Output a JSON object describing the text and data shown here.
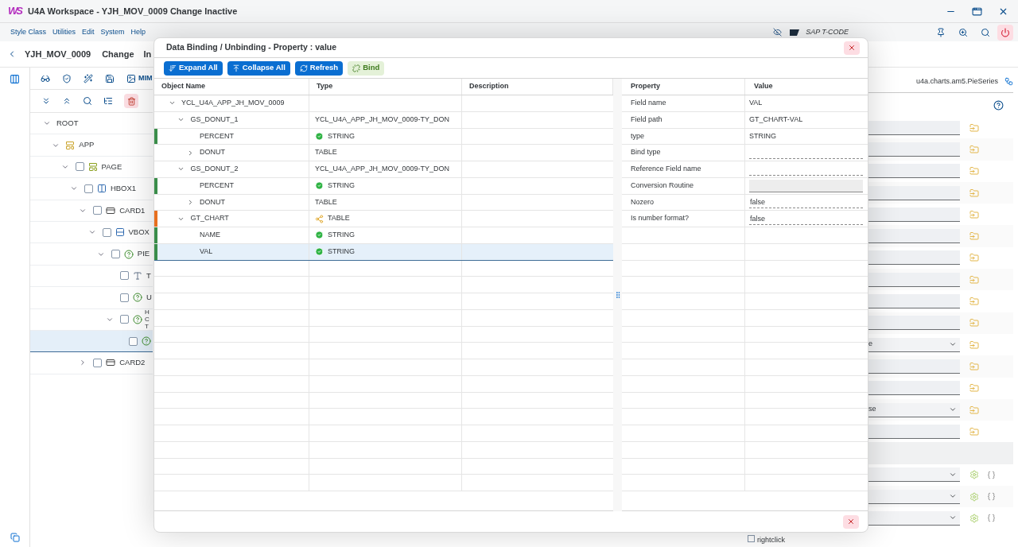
{
  "window": {
    "title": "U4A Workspace - YJH_MOV_0009 Change Inactive",
    "logo": "WS"
  },
  "menu": [
    "Style Class",
    "Utilities",
    "Edit",
    "System",
    "Help"
  ],
  "tcode": "SAP T-CODE",
  "header": {
    "app": "YJH_MOV_0009",
    "mode": "Change",
    "status": "In"
  },
  "toolbar": {
    "cut_label": "MIM"
  },
  "tree": [
    {
      "label": "ROOT",
      "expanded": true,
      "selected": false,
      "children": [
        {
          "label": "APP",
          "kind": "app",
          "expanded": true,
          "selected": false,
          "children": [
            {
              "label": "PAGE",
              "kind": "page",
              "expanded": true,
              "checked": false,
              "selected": false,
              "children": [
                {
                  "label": "HBOX1",
                  "kind": "hbox",
                  "expanded": true,
                  "checked": false,
                  "selected": false,
                  "children": [
                    {
                      "label": "CARD1",
                      "kind": "card",
                      "expanded": true,
                      "checked": false,
                      "selected": false,
                      "children": [
                        {
                          "label": "VBOX",
                          "kind": "vbox",
                          "expanded": true,
                          "checked": false,
                          "selected": false,
                          "children": [
                            {
                              "label": "PIE",
                              "kind": "chart",
                              "expanded": true,
                              "checked": false,
                              "selected": false,
                              "children": [
                                {
                                  "label": "T",
                                  "kind": "text",
                                  "checked": false,
                                  "selected": false
                                },
                                {
                                  "label": "U",
                                  "kind": "chart",
                                  "checked": false,
                                  "selected": false
                                },
                                {
                                  "lines": [
                                    "H",
                                    "C",
                                    "T"
                                  ],
                                  "kind": "chart",
                                  "expanded": true,
                                  "checked": false,
                                  "selected": false,
                                  "children": [
                                    {
                                      "kind": "chart",
                                      "checked": false,
                                      "selected": true
                                    }
                                  ]
                                }
                              ]
                            }
                          ]
                        }
                      ]
                    },
                    {
                      "label": "CARD2",
                      "kind": "card",
                      "expanded": false,
                      "checked": false,
                      "selected": false
                    }
                  ]
                }
              ]
            }
          ]
        }
      ]
    }
  ],
  "panel": {
    "class_name": "u4a.charts.am5.PieSeries",
    "rows": [
      {
        "kind": "field"
      },
      {
        "kind": "field"
      },
      {
        "kind": "field"
      },
      {
        "kind": "field"
      },
      {
        "kind": "field"
      },
      {
        "kind": "field"
      },
      {
        "kind": "field"
      },
      {
        "kind": "field"
      },
      {
        "kind": "field"
      },
      {
        "kind": "field"
      },
      {
        "kind": "choice",
        "value": "e"
      },
      {
        "kind": "field"
      },
      {
        "kind": "field"
      },
      {
        "kind": "choice",
        "value": "se"
      },
      {
        "kind": "field"
      },
      {
        "kind": "blank"
      },
      {
        "kind": "setting"
      },
      {
        "kind": "setting"
      },
      {
        "kind": "setting"
      }
    ],
    "rightclick": {
      "label": "rightclick",
      "checked": false
    }
  },
  "dialog": {
    "title": "Data Binding / Unbinding - Property : value",
    "buttons": [
      {
        "label": "Expand All",
        "kind": "expand"
      },
      {
        "label": "Collapse All",
        "kind": "collapse"
      },
      {
        "label": "Refresh",
        "kind": "refresh"
      },
      {
        "label": "Bind",
        "kind": "bind"
      }
    ],
    "columns": [
      "Object Name",
      "Type",
      "Description"
    ],
    "rows": [
      {
        "name": "YCL_U4A_APP_JH_MOV_0009",
        "expanded": true,
        "selected": false,
        "children": [
          {
            "name": "GS_DONUT_1",
            "type": "YCL_U4A_APP_JH_MOV_0009-TY_DON",
            "expanded": true,
            "selected": false,
            "children": [
              {
                "name": "PERCENT",
                "type": "STRING",
                "kind": "check",
                "color": "#3a8d4a",
                "selected": false
              },
              {
                "name": "DONUT",
                "type": "TABLE",
                "expanded": false,
                "selected": false
              }
            ]
          },
          {
            "name": "GS_DONUT_2",
            "type": "YCL_U4A_APP_JH_MOV_0009-TY_DON",
            "expanded": true,
            "selected": false,
            "children": [
              {
                "name": "PERCENT",
                "type": "STRING",
                "kind": "check",
                "color": "#3a8d4a",
                "selected": false
              },
              {
                "name": "DONUT",
                "type": "TABLE",
                "expanded": false,
                "selected": false
              }
            ]
          },
          {
            "name": "GT_CHART",
            "type": "TABLE",
            "kind": "share",
            "color": "#e76f1f",
            "expanded": true,
            "selected": false,
            "children": [
              {
                "name": "NAME",
                "type": "STRING",
                "kind": "check",
                "color": "#3a8d4a",
                "selected": false
              },
              {
                "name": "VAL",
                "type": "STRING",
                "kind": "check",
                "color": "#3a8d4a",
                "selected": true
              }
            ]
          }
        ]
      }
    ],
    "prop_columns": [
      "Property",
      "Value"
    ],
    "props": [
      {
        "name": "Field name",
        "value": "VAL",
        "kind": "text"
      },
      {
        "name": "Field path",
        "value": "GT_CHART-VAL",
        "kind": "text"
      },
      {
        "name": "type",
        "value": "STRING",
        "kind": "text"
      },
      {
        "name": "Bind type",
        "kind": "input"
      },
      {
        "name": "Reference Field name",
        "kind": "input"
      },
      {
        "name": "Conversion Routine",
        "kind": "readonly"
      },
      {
        "name": "Nozero",
        "value": "false",
        "kind": "input"
      },
      {
        "name": "Is number format?",
        "value": "false",
        "kind": "input"
      }
    ]
  }
}
